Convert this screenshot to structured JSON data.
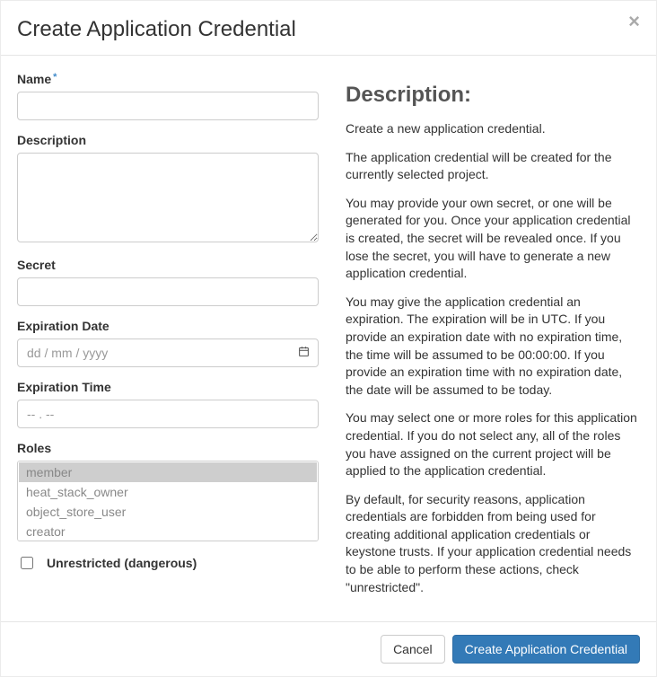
{
  "modal": {
    "title": "Create Application Credential",
    "close_label": "×"
  },
  "form": {
    "name": {
      "label": "Name",
      "value": "",
      "required": true
    },
    "description": {
      "label": "Description",
      "value": ""
    },
    "secret": {
      "label": "Secret",
      "value": ""
    },
    "expiration_date": {
      "label": "Expiration Date",
      "placeholder": "dd / mm / yyyy",
      "value": ""
    },
    "expiration_time": {
      "label": "Expiration Time",
      "placeholder": "-- . --",
      "value": ""
    },
    "roles": {
      "label": "Roles",
      "options": [
        "member",
        "heat_stack_owner",
        "object_store_user",
        "creator"
      ],
      "selected": [
        "member"
      ]
    },
    "unrestricted": {
      "label": "Unrestricted (dangerous)",
      "checked": false
    }
  },
  "help": {
    "heading": "Description:",
    "paragraphs": [
      "Create a new application credential.",
      "The application credential will be created for the currently selected project.",
      "You may provide your own secret, or one will be generated for you. Once your application credential is created, the secret will be revealed once. If you lose the secret, you will have to generate a new application credential.",
      "You may give the application credential an expiration. The expiration will be in UTC. If you provide an expiration date with no expiration time, the time will be assumed to be 00:00:00. If you provide an expiration time with no expiration date, the date will be assumed to be today.",
      "You may select one or more roles for this application credential. If you do not select any, all of the roles you have assigned on the current project will be applied to the application credential.",
      "By default, for security reasons, application credentials are forbidden from being used for creating additional application credentials or keystone trusts. If your application credential needs to be able to perform these actions, check \"unrestricted\"."
    ]
  },
  "footer": {
    "cancel_label": "Cancel",
    "submit_label": "Create Application Credential"
  }
}
